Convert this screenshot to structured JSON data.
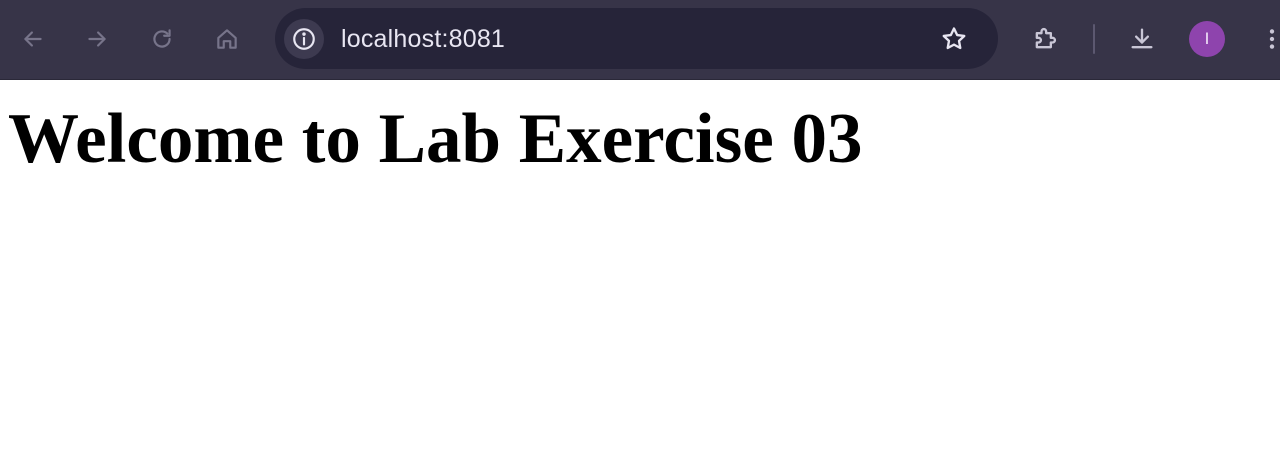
{
  "browser": {
    "url": "localhost:8081",
    "profile_initial": "I",
    "icons": {
      "back": "back-arrow-icon",
      "forward": "forward-arrow-icon",
      "reload": "reload-icon",
      "home": "home-icon",
      "site_info": "info-icon",
      "bookmark": "star-icon",
      "extensions": "puzzle-icon",
      "downloads": "download-icon",
      "menu": "kebab-menu-icon"
    },
    "colors": {
      "toolbar": "#373448",
      "omnibox": "#262439",
      "avatar": "#8e44ad"
    }
  },
  "page": {
    "heading": "Welcome to Lab Exercise 03"
  }
}
